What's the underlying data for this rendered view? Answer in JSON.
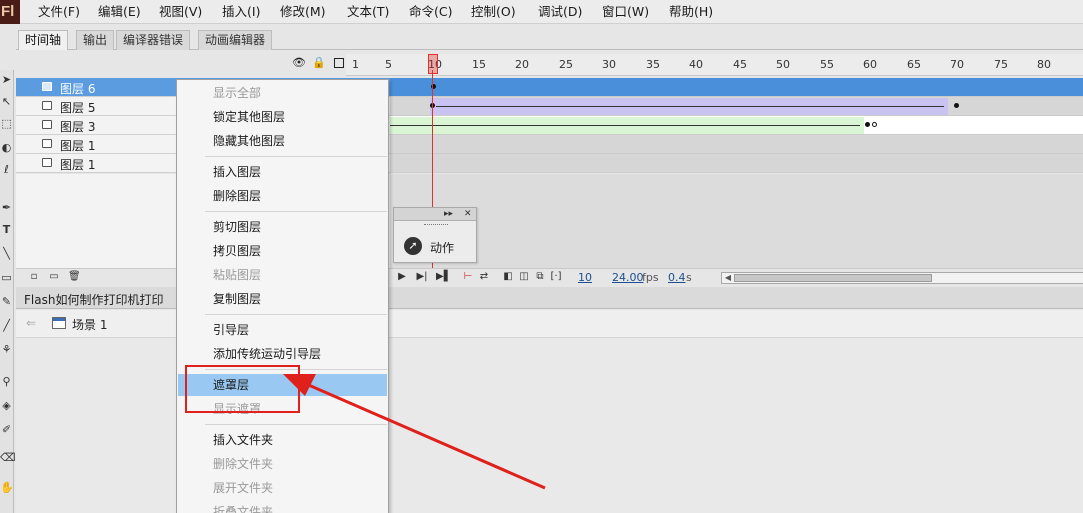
{
  "app": {
    "logo": "Fl"
  },
  "menubar": {
    "items": [
      "文件(F)",
      "编辑(E)",
      "视图(V)",
      "插入(I)",
      "修改(M)",
      "文本(T)",
      "命令(C)",
      "控制(O)",
      "调试(D)",
      "窗口(W)",
      "帮助(H)"
    ]
  },
  "panel_tabs": [
    "时间轴",
    "输出",
    "编译器错误",
    "动画编辑器"
  ],
  "ruler": {
    "labels": [
      "1",
      "5",
      "10",
      "15",
      "20",
      "25",
      "30",
      "35",
      "40",
      "45",
      "50",
      "55",
      "60",
      "65",
      "70",
      "75",
      "80"
    ]
  },
  "layers": [
    {
      "name": "图层 6",
      "selected": true
    },
    {
      "name": "图层 5",
      "selected": false
    },
    {
      "name": "图层 3",
      "selected": false
    },
    {
      "name": "图层 1",
      "selected": false
    },
    {
      "name": "图层 1",
      "selected": false
    }
  ],
  "colors": {
    "selection": "#5b9be0",
    "motion_tween": "#c8c3f0",
    "shape_tween": "#d9f5d3",
    "playhead": "#e0322d",
    "menu_highlight": "#99c9f2",
    "annotation": "#e0201b"
  },
  "timeline_footer": {
    "current_frame": "10",
    "frame_rate": "24.00",
    "frame_rate_unit": "fps",
    "elapsed_time": "0.4",
    "elapsed_unit": "s"
  },
  "actions_panel": {
    "label": "动作",
    "icon": "actions-arrow-icon"
  },
  "document": {
    "tab_title": "Flash如何制作打印机打印",
    "scene_label": "场景 1"
  },
  "context_menu": {
    "items": [
      {
        "label": "显示全部",
        "disabled": true
      },
      {
        "label": "锁定其他图层",
        "disabled": false
      },
      {
        "label": "隐藏其他图层",
        "disabled": false
      },
      {
        "separator": true
      },
      {
        "label": "插入图层",
        "disabled": false
      },
      {
        "label": "删除图层",
        "disabled": false
      },
      {
        "separator": true
      },
      {
        "label": "剪切图层",
        "disabled": false
      },
      {
        "label": "拷贝图层",
        "disabled": false
      },
      {
        "label": "粘贴图层",
        "disabled": true
      },
      {
        "label": "复制图层",
        "disabled": false
      },
      {
        "separator": true
      },
      {
        "label": "引导层",
        "disabled": false
      },
      {
        "label": "添加传统运动引导层",
        "disabled": false
      },
      {
        "separator": true
      },
      {
        "label": "遮罩层",
        "disabled": false,
        "highlighted": true
      },
      {
        "label": "显示遮罩",
        "disabled": true
      },
      {
        "separator": true
      },
      {
        "label": "插入文件夹",
        "disabled": false
      },
      {
        "label": "删除文件夹",
        "disabled": true
      },
      {
        "label": "展开文件夹",
        "disabled": true
      },
      {
        "label": "折叠文件夹",
        "disabled": true
      }
    ]
  }
}
